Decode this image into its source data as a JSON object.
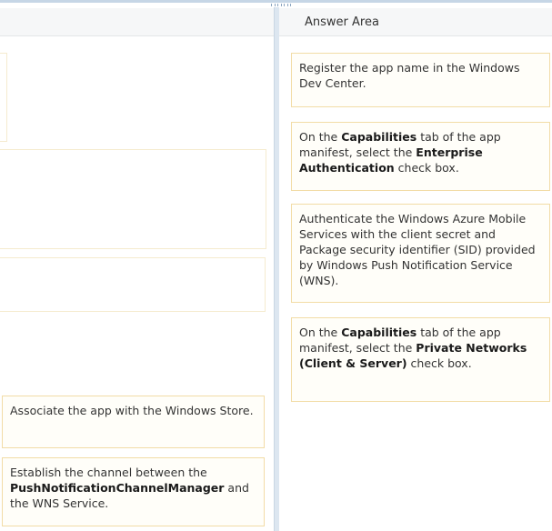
{
  "answer_area": {
    "title": "Answer Area"
  },
  "left_items": [
    {
      "id": "associate",
      "parts": [
        {
          "text": "Associate the app with the Windows Store.",
          "bold": false
        }
      ]
    },
    {
      "id": "establish",
      "parts": [
        {
          "text": "Establish the channel between the ",
          "bold": false
        },
        {
          "text": "PushNotificationChannelManager",
          "bold": true
        },
        {
          "text": " and the WNS Service.",
          "bold": false
        }
      ]
    }
  ],
  "right_items": [
    {
      "id": "register",
      "parts": [
        {
          "text": "Register the app name in the Windows Dev Center.",
          "bold": false
        }
      ]
    },
    {
      "id": "enterprise-auth",
      "parts": [
        {
          "text": "On the ",
          "bold": false
        },
        {
          "text": "Capabilities",
          "bold": true
        },
        {
          "text": " tab of the app manifest, select the ",
          "bold": false
        },
        {
          "text": "Enterprise Authentication",
          "bold": true
        },
        {
          "text": " check box.",
          "bold": false
        }
      ]
    },
    {
      "id": "authenticate-azure",
      "parts": [
        {
          "text": "Authenticate the Windows Azure Mobile Services with the client secret and Package security identifier (SID) provided by Windows Push Notification Service (WNS).",
          "bold": false
        }
      ]
    },
    {
      "id": "private-networks",
      "parts": [
        {
          "text": "On the ",
          "bold": false
        },
        {
          "text": "Capabilities",
          "bold": true
        },
        {
          "text": " tab of the app manifest, select the ",
          "bold": false
        },
        {
          "text": "Private Networks (Client & Server)",
          "bold": true
        },
        {
          "text": " check box.",
          "bold": false
        }
      ]
    }
  ]
}
